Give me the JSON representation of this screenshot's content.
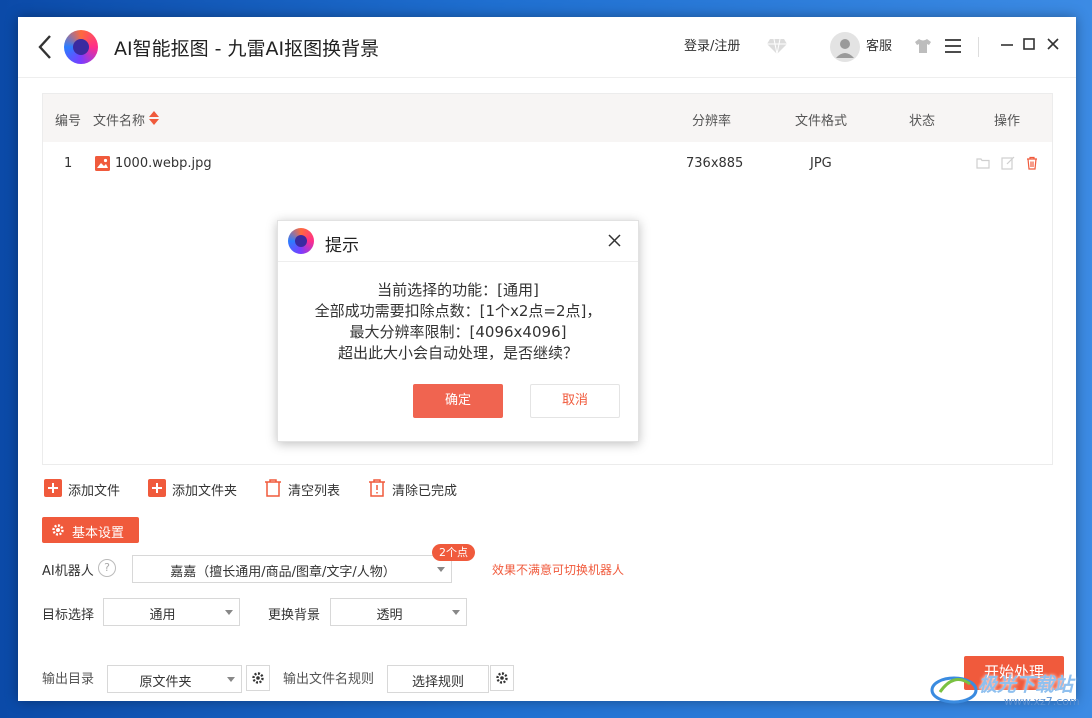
{
  "app": {
    "title": "AI智能抠图 - 九雷AI抠图换背景",
    "login": "登录/注册",
    "service": "客服"
  },
  "table": {
    "headers": {
      "index": "编号",
      "name": "文件名称",
      "resolution": "分辨率",
      "format": "文件格式",
      "status": "状态",
      "ops": "操作"
    },
    "rows": [
      {
        "index": "1",
        "name": "1000.webp.jpg",
        "resolution": "736x885",
        "format": "JPG",
        "status": ""
      }
    ]
  },
  "actions": {
    "add_file": "添加文件",
    "add_folder": "添加文件夹",
    "clear_list": "清空列表",
    "clear_done": "清除已完成"
  },
  "settings": {
    "basic": "基本设置",
    "robot_label": "AI机器人",
    "robot_value": "嘉嘉（擅长通用/商品/图章/文字/人物）",
    "cost_badge": "2个点",
    "robot_hint": "效果不满意可切换机器人",
    "target_label": "目标选择",
    "target_value": "通用",
    "bg_label": "更换背景",
    "bg_value": "透明",
    "output_label": "输出目录",
    "output_value": "原文件夹",
    "rule_label": "输出文件名规则",
    "rule_value": "选择规则",
    "start": "开始处理"
  },
  "dialog": {
    "title": "提示",
    "lines": [
      "当前选择的功能：[通用]",
      "全部成功需要扣除点数：[1个x2点=2点]，",
      "最大分辨率限制：[4096x4096]",
      "超出此大小会自动处理，是否继续？"
    ],
    "ok": "确定",
    "cancel": "取消"
  },
  "watermark": {
    "text": "极光下载站",
    "url": "www.xz7.com"
  },
  "colors": {
    "accent": "#f05a3c",
    "dialog_ok": "#f06450"
  }
}
